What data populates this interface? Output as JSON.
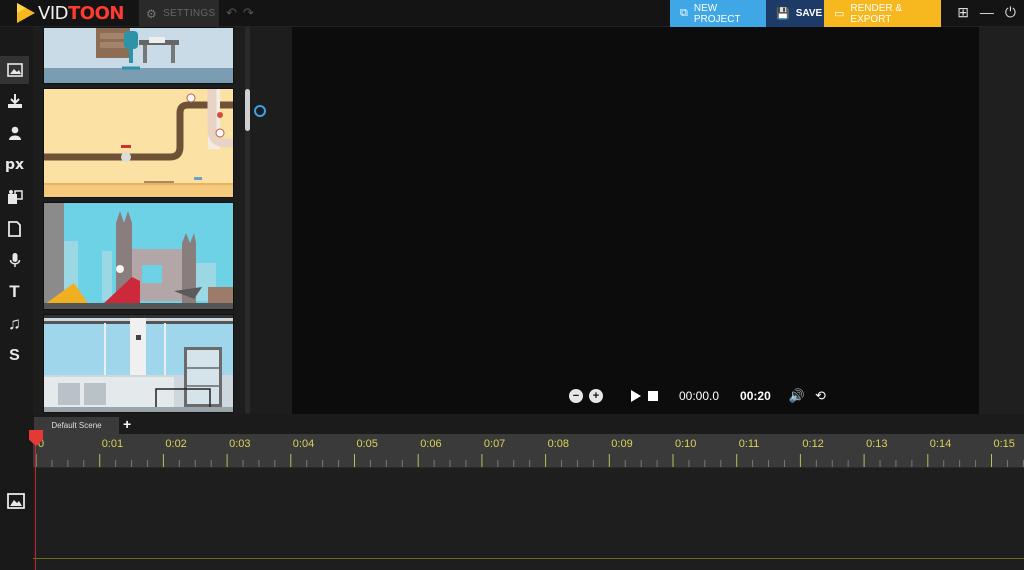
{
  "app": {
    "logo_vid": "VID",
    "logo_toon": "TOON",
    "settings_label": "SETTINGS",
    "new_project_label": "NEW PROJECT",
    "save_label": "SAVE",
    "render_label": "RENDER & EXPORT",
    "accent_new": "#3fa7e6",
    "accent_save": "#1e3a67",
    "accent_render": "#f7b81f"
  },
  "rail": {
    "items": [
      {
        "name": "background-icon"
      },
      {
        "name": "import-icon"
      },
      {
        "name": "character-icon"
      },
      {
        "name": "px-icon",
        "label": "px"
      },
      {
        "name": "props-icon"
      },
      {
        "name": "text-box-icon"
      },
      {
        "name": "microphone-icon"
      },
      {
        "name": "text-icon",
        "label": "T"
      },
      {
        "name": "music-icon",
        "label": "♫"
      },
      {
        "name": "sound-effect-icon",
        "label": "S"
      }
    ]
  },
  "player": {
    "current_time": "00:00.0",
    "duration": "00:20"
  },
  "timeline": {
    "scene_tab": "Default Scene",
    "add_label": "+",
    "ticks": [
      "0",
      "0:01",
      "0:02",
      "0:03",
      "0:04",
      "0:05",
      "0:06",
      "0:07",
      "0:08",
      "0:09",
      "0:10",
      "0:11",
      "0:12",
      "0:13",
      "0:14",
      "0:15"
    ]
  }
}
